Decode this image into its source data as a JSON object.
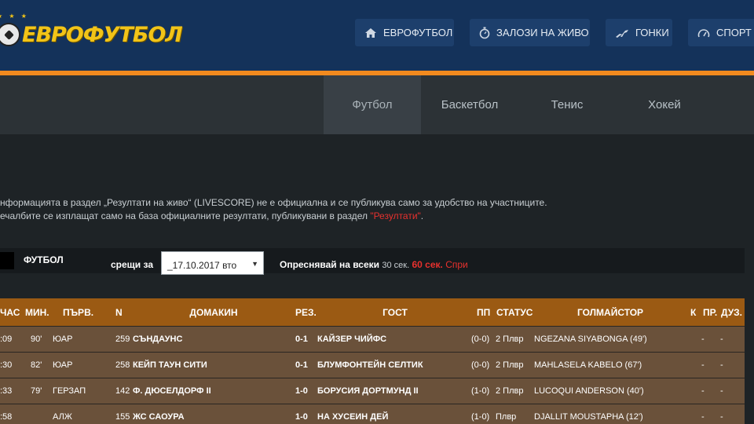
{
  "header": {
    "logo_text": "ЕВРОФУТБОЛ",
    "nav": [
      {
        "label": "ЕВРОФУТБОЛ",
        "icon": "home-icon"
      },
      {
        "label": "ЗАЛОЗИ НА ЖИВО",
        "icon": "stopwatch-icon"
      },
      {
        "label": "ГОНКИ",
        "icon": "running-dog-icon"
      },
      {
        "label": "СПОРТ М",
        "icon": "speedometer-icon"
      }
    ]
  },
  "sport_tabs": [
    {
      "label": "Футбол",
      "active": true
    },
    {
      "label": "Баскетбол",
      "active": false
    },
    {
      "label": "Тенис",
      "active": false
    },
    {
      "label": "Хокей",
      "active": false
    }
  ],
  "notice": {
    "line1": "нформацията в раздел „Резултати на живо“ (LIVESCORE) не е официална и се публикува само за удобство на участниците.",
    "line2_prefix": "ечалбите се изплащат само на база официалните резултати, публикувани в раздел ",
    "line2_link": "\"Резултати\"",
    "line2_suffix": "."
  },
  "filter": {
    "sport": "ФУТБОЛ",
    "date_label": "срещи за",
    "date_value": "_17.10.2017 вто",
    "refresh_label": "Опреснявай на всеки",
    "refresh_option": "30 сек.",
    "refresh_selected": "60 сек.",
    "stop_label": "Спри"
  },
  "table": {
    "columns": [
      "ЧАС",
      "МИН.",
      "ПЪРВ.",
      "N",
      "ДОМАКИН",
      "РЕЗ.",
      "ГОСТ",
      "ПП",
      "СТАТУС",
      "ГОЛМАЙСТОР",
      "К",
      "ПР.",
      "ДУЗ."
    ],
    "rows": [
      {
        "time": ":09",
        "min": "90'",
        "league": "ЮАР",
        "n": "259",
        "home": "СЪНДАУНС",
        "score": "0-1",
        "away": "КАЙЗЕР ЧИЙФС",
        "ht": "(0-0)",
        "status": "2 Плвр",
        "scorer": "NGEZANA SIYABONGA (49')",
        "k": "-",
        "pr": "-",
        "duz": ""
      },
      {
        "time": ":30",
        "min": "82'",
        "league": "ЮАР",
        "n": "258",
        "home": "КЕЙП ТАУН СИТИ",
        "score": "0-1",
        "away": "БЛУМФОНТЕЙН СЕЛТИК",
        "ht": "(0-0)",
        "status": "2 Плвр",
        "scorer": "MAHLASELA KABELO (67')",
        "k": "-",
        "pr": "-",
        "duz": ""
      },
      {
        "time": ":33",
        "min": "79'",
        "league": "ГЕРЗАП",
        "n": "142",
        "home": "Ф. ДЮСЕЛДОРФ II",
        "score": "1-0",
        "away": "БОРУСИЯ ДОРТМУНД II",
        "ht": "(1-0)",
        "status": "2 Плвр",
        "scorer": "LUCOQUI ANDERSON (40')",
        "k": "-",
        "pr": "-",
        "duz": ""
      },
      {
        "time": ":58",
        "min": "",
        "league": "АЛЖ",
        "n": "155",
        "home": "ЖС САОУРА",
        "score": "1-0",
        "away": "НА ХУСЕИН ДЕЙ",
        "ht": "(1-0)",
        "status": "Плвр",
        "scorer": "DJALLIT MOUSTAPHA (12')",
        "k": "-",
        "pr": "-",
        "duz": ""
      }
    ]
  }
}
